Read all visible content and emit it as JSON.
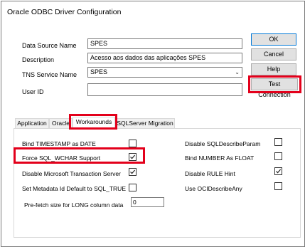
{
  "window": {
    "title": "Oracle ODBC Driver Configuration"
  },
  "form": {
    "data_source_name": {
      "label": "Data Source Name",
      "value": "SPES"
    },
    "description": {
      "label": "Description",
      "value": "Acesso aos dados das aplicações SPES"
    },
    "tns_service_name": {
      "label": "TNS Service Name",
      "value": "SPES"
    },
    "user_id": {
      "label": "User ID",
      "value": ""
    }
  },
  "buttons": {
    "ok": "OK",
    "cancel": "Cancel",
    "help": "Help",
    "test_connection": "Test Connection"
  },
  "tabs": [
    "Application",
    "Oracle",
    "Workarounds",
    "SQLServer Migration"
  ],
  "active_tab": "Workarounds",
  "options_left": [
    {
      "label": "Bind TIMESTAMP as DATE",
      "checked": false
    },
    {
      "label": "Force SQL_WCHAR Support",
      "checked": true
    },
    {
      "label": "Disable Microsoft Transaction Server",
      "checked": true
    },
    {
      "label": "Set Metadata Id Default to SQL_TRUE",
      "checked": false
    }
  ],
  "options_right": [
    {
      "label": "Disable SQLDescribeParam",
      "checked": false
    },
    {
      "label": "Bind NUMBER As FLOAT",
      "checked": false
    },
    {
      "label": "Disable RULE Hint",
      "checked": true
    },
    {
      "label": "Use OCIDescribeAny",
      "checked": false
    }
  ],
  "prefetch": {
    "label": "Pre-fetch size for LONG column data",
    "value": "0"
  },
  "highlight_color": "#e3001b"
}
